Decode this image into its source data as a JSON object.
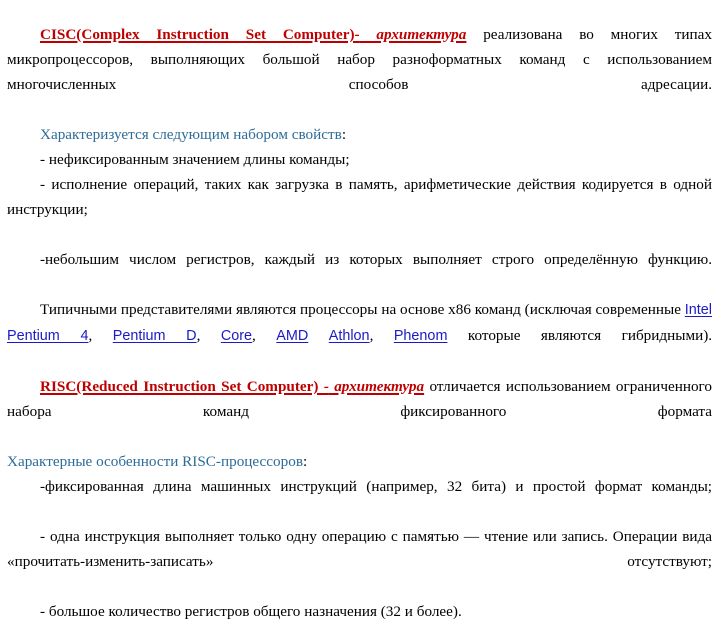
{
  "document": {
    "type": "slide",
    "language": "ru",
    "background_color": "#ffffff",
    "colors": {
      "heading_red": "#C00000",
      "subheading_blue": "#2E6C98",
      "hyperlink_blue": "#1A1AC8",
      "body_black": "#000000"
    }
  },
  "content": {
    "cisc": {
      "title_main": "CISC(Complex Instruction Set Computer)-",
      "title_italic": " архитектура",
      "intro_body": " реализована во многих типах микропроцессоров, выполняющих большой набор разноформатных команд с использованием многочисленных способов адресации.",
      "properties_lead": "Характеризуется следующим набором свойств",
      "properties_lead_colon": ":",
      "bullets": [
        "- нефиксированным значением длины команды;",
        "- исполнение операций, таких как загрузка в память, арифметические действия кодируется в одной инструкции;",
        "-небольшим числом регистров, каждый из которых выполняет строго определённую функцию."
      ],
      "representatives_prefix": "Типичными представителями являются процессоры на основе x86 команд (исключая современные ",
      "links": [
        {
          "label": "Intel"
        },
        {
          "label": "Pentium 4"
        },
        {
          "label": "Pentium D"
        },
        {
          "label": "Core"
        },
        {
          "label": "AMD"
        },
        {
          "label": "Athlon"
        },
        {
          "label": "Phenom"
        }
      ],
      "link_separator": ", ",
      "link_space": " ",
      "representatives_suffix": " которые являются гибридными)."
    },
    "risc": {
      "title_main": "RISC(Reduced Instruction Set Computer) -",
      "title_italic": " архитектура",
      "intro_body": " отличается использованием ограниченного набора команд фиксированного формата",
      "features_lead": "Характерные особенности RISC-процессоров",
      "features_lead_colon": ":",
      "bullets": [
        "-фиксированная длина машинных инструкций (например, 32 бита) и простой формат команды;",
        "- одна инструкция выполняет только одну операцию с памятью — чтение или запись. Операции вида «прочитать-изменить-записать» отсутствуют;",
        "- большое количество регистров общего назначения (32 и более)."
      ]
    }
  }
}
